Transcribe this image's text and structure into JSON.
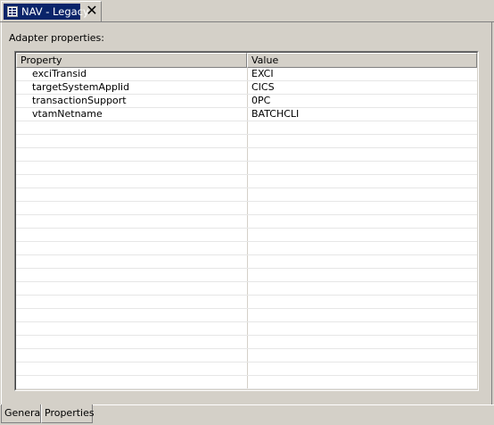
{
  "editor_tab": {
    "title": "NAV - Legacy",
    "close_glyph": "✕",
    "icon": "editor-file-icon",
    "active_color": "#0a246a"
  },
  "section": {
    "label": "Adapter properties:"
  },
  "table": {
    "columns": [
      "Property",
      "Value"
    ],
    "rows": [
      {
        "property": "exciTransid",
        "value": "EXCI"
      },
      {
        "property": "targetSystemApplid",
        "value": "CICS"
      },
      {
        "property": "transactionSupport",
        "value": "0PC"
      },
      {
        "property": "vtamNetname",
        "value": "BATCHCLI"
      }
    ]
  },
  "page_tabs": [
    {
      "label": "General",
      "active": false
    },
    {
      "label": "Properties",
      "active": true
    }
  ]
}
